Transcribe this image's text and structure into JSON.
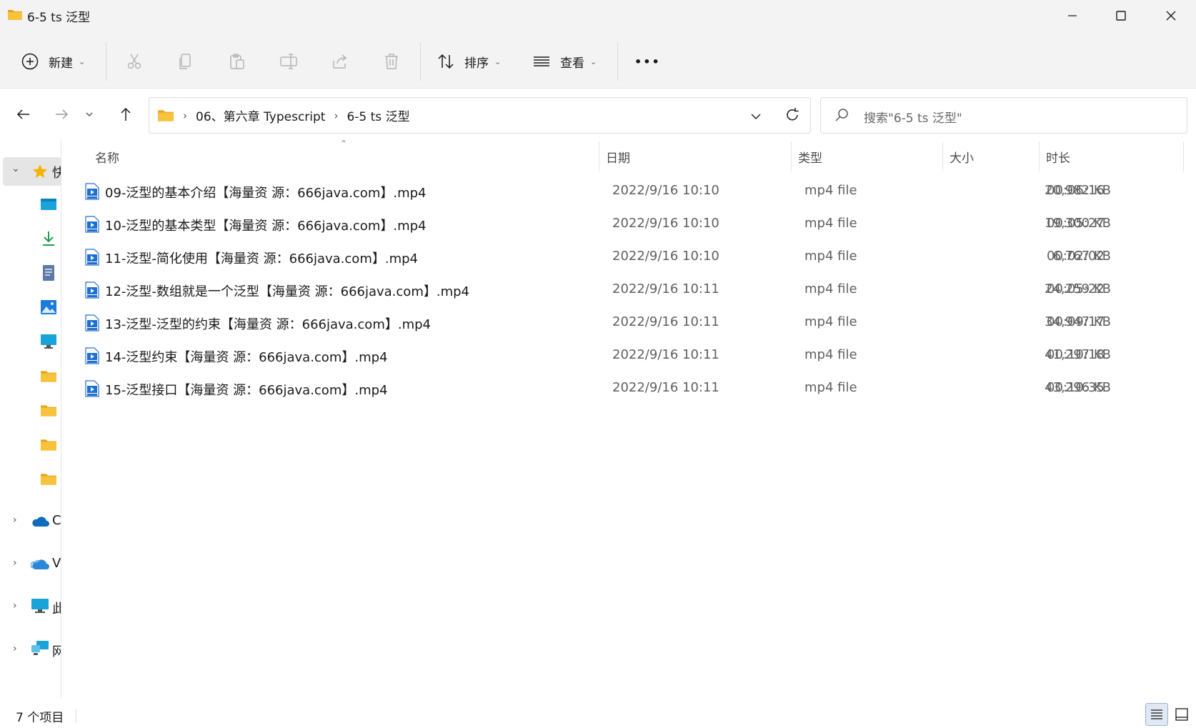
{
  "window": {
    "title": "6-5 ts 泛型",
    "controls": {
      "minimize": "minimize",
      "maximize": "maximize",
      "close": "close"
    }
  },
  "toolbar": {
    "new_label": "新建",
    "sort_label": "排序",
    "view_label": "查看",
    "more_label": "•••",
    "icons": [
      "plus-circle-icon",
      "cut-icon",
      "copy-icon",
      "paste-icon",
      "rename-icon",
      "share-icon",
      "delete-icon",
      "sort-icon",
      "view-icon",
      "more-icon"
    ]
  },
  "address": {
    "crumbs": [
      "06、第六章 Typescript",
      "6-5 ts 泛型"
    ],
    "search_placeholder": "搜索\"6-5 ts 泛型\""
  },
  "sidebar": {
    "quick_access_label": "快",
    "pinned_icons": [
      "desktop-icon",
      "downloads-icon",
      "documents-icon",
      "pictures-icon",
      "monitor-icon",
      "folder-icon",
      "folder-icon",
      "folder-icon",
      "folder-icon"
    ],
    "groups": [
      {
        "label": "C",
        "icon": "onedrive-icon"
      },
      {
        "label": "V",
        "icon": "onedrive-personal-icon"
      },
      {
        "label": "此",
        "icon": "this-pc-icon"
      },
      {
        "label": "网",
        "icon": "network-icon"
      }
    ]
  },
  "columns": {
    "name": "名称",
    "date": "日期",
    "type": "类型",
    "size": "大小",
    "duration": "时长"
  },
  "files": [
    {
      "name": "09-泛型的基本介绍【海量资 源：666java.com】.mp4",
      "date": "2022/9/16 10:10",
      "type": "mp4 file",
      "size": "20,982 KB",
      "duration": "00:06:16"
    },
    {
      "name": "10-泛型的基本类型【海量资 源：666java.com】.mp4",
      "date": "2022/9/16 10:10",
      "type": "mp4 file",
      "size": "19,300 KB",
      "duration": "00:05:27"
    },
    {
      "name": "11-泛型-简化使用【海量资 源：666java.com】.mp4",
      "date": "2022/9/16 10:10",
      "type": "mp4 file",
      "size": "6,767 KB",
      "duration": "00:02:02"
    },
    {
      "name": "12-泛型-数组就是一个泛型【海量资 源：666java.com】.mp4",
      "date": "2022/9/16 10:11",
      "type": "mp4 file",
      "size": "24,259 KB",
      "duration": "00:05:22"
    },
    {
      "name": "13-泛型-泛型的约束【海量资 源：666java.com】.mp4",
      "date": "2022/9/16 10:11",
      "type": "mp4 file",
      "size": "34,947 KB",
      "duration": "00:09:17"
    },
    {
      "name": "14-泛型约束【海量资 源：666java.com】.mp4",
      "date": "2022/9/16 10:11",
      "type": "mp4 file",
      "size": "41,297 KB",
      "duration": "00:10:18"
    },
    {
      "name": "15-泛型接口【海量资 源：666java.com】.mp4",
      "date": "2022/9/16 10:11",
      "type": "mp4 file",
      "size": "43,296 KB",
      "duration": "00:10:35"
    }
  ],
  "status": {
    "item_count": "7 个项目"
  },
  "colors": {
    "accent": "#0067c0",
    "folder": "#f8c33c",
    "chrome": "#f3f3f3"
  }
}
